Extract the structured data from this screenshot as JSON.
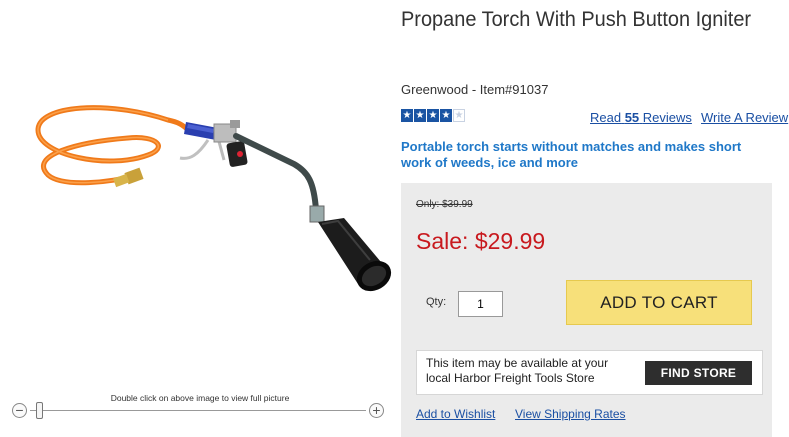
{
  "product": {
    "title": "Propane Torch With Push Button Igniter",
    "brand_item": "Greenwood - Item#91037",
    "tagline": "Portable torch starts without matches and makes short work of weeds, ice and more"
  },
  "image": {
    "zoom_hint": "Double click on above image to view full picture",
    "zoom_out_symbol": "−",
    "zoom_in_symbol": "+",
    "icon": "propane-torch-image"
  },
  "reviews": {
    "rating": 4,
    "max_rating": 5,
    "read_prefix": "Read",
    "count": "55",
    "read_suffix": "Reviews",
    "write_label": "Write A Review",
    "star_icon": "star-icon",
    "star_color": "#1a54a3"
  },
  "pricing": {
    "was_price": "Only: $39.99",
    "sale_price": "Sale: $29.99",
    "sale_color": "#c8191e"
  },
  "cart": {
    "qty_label": "Qty:",
    "qty_value": "1",
    "add_to_cart_label": "ADD TO CART",
    "button_color": "#f7e07a"
  },
  "store": {
    "availability_text": "This item may be available at your local Harbor Freight Tools Store",
    "find_store_label": "FIND STORE"
  },
  "links": {
    "wishlist": "Add to Wishlist",
    "shipping": "View Shipping Rates"
  }
}
